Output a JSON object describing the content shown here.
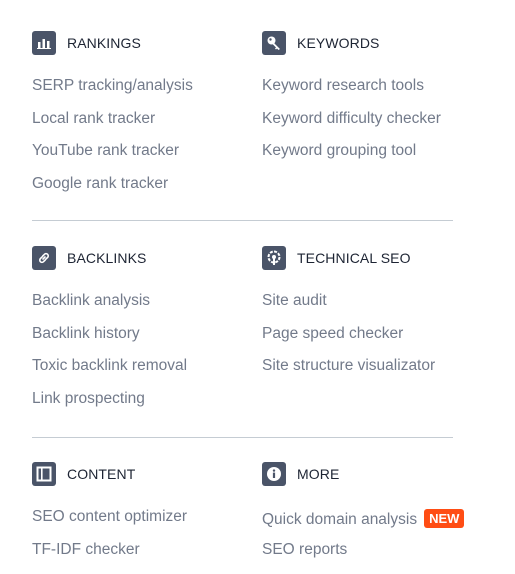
{
  "sections": [
    {
      "left": {
        "title": "RANKINGS",
        "icon": "bar-chart-icon",
        "links": [
          "SERP tracking/analysis",
          "Local rank tracker",
          "YouTube rank tracker",
          "Google rank tracker"
        ]
      },
      "right": {
        "title": "KEYWORDS",
        "icon": "key-icon",
        "links": [
          "Keyword research tools",
          "Keyword difficulty checker",
          "Keyword grouping tool"
        ]
      }
    },
    {
      "left": {
        "title": "BACKLINKS",
        "icon": "link-icon",
        "links": [
          "Backlink analysis",
          "Backlink history",
          "Toxic backlink removal",
          "Link prospecting"
        ]
      },
      "right": {
        "title": "TECHNICAL SEO",
        "icon": "gear-wrench-icon",
        "links": [
          "Site audit",
          "Page speed checker",
          "Site structure visualizator"
        ]
      }
    },
    {
      "left": {
        "title": "CONTENT",
        "icon": "layout-icon",
        "links": [
          "SEO content optimizer",
          "TF-IDF checker"
        ]
      },
      "right": {
        "title": "MORE",
        "icon": "info-icon",
        "links": [
          "Quick domain analysis",
          "SEO reports"
        ],
        "badge": "NEW"
      }
    }
  ],
  "colors": {
    "icon_bg": "#4a5468",
    "heading": "#1d2433",
    "link": "#727a8a",
    "divider": "#c5ccd3",
    "badge": "#ff4d14"
  }
}
